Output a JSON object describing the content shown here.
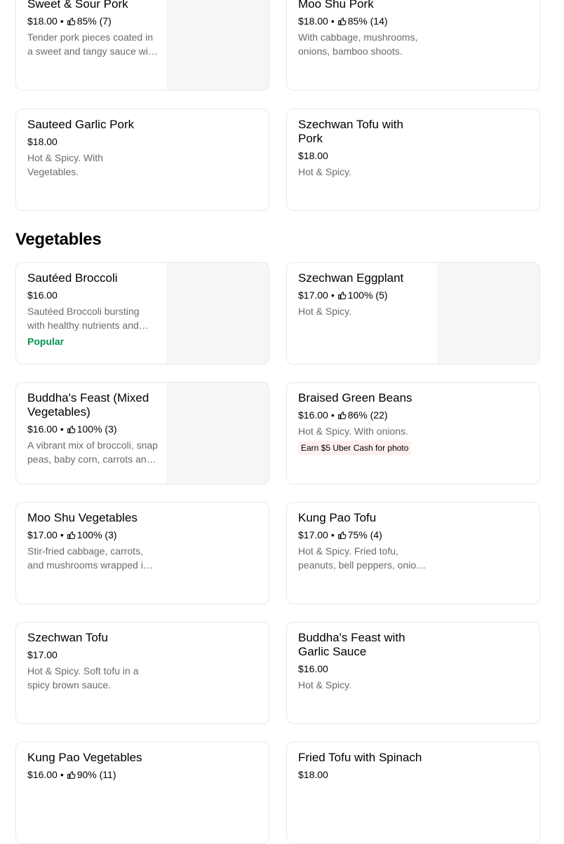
{
  "section": {
    "title": "Vegetables"
  },
  "items": [
    {
      "name": "Sweet & Sour Pork",
      "price": "$18.00",
      "rating": "85% (7)",
      "desc": "Tender pork pieces coated in a sweet and tangy sauce with pineapple and peppers."
    },
    {
      "name": "Moo Shu Pork",
      "price": "$18.00",
      "rating": "85% (14)",
      "desc": "With cabbage, mushrooms, onions, bamboo shoots."
    },
    {
      "name": "Sauteed Garlic Pork",
      "price": "$18.00",
      "desc": "Hot & Spicy. With Vegetables."
    },
    {
      "name": "Szechwan Tofu with Pork",
      "price": "$18.00",
      "desc": "Hot & Spicy."
    },
    {
      "name": "Sautéed Broccoli",
      "price": "$16.00",
      "desc": "Sautéed Broccoli bursting with healthy nutrients and flavor.",
      "badge": "Popular"
    },
    {
      "name": "Szechwan Eggplant",
      "price": "$17.00",
      "rating": "100% (5)",
      "desc": "Hot & Spicy."
    },
    {
      "name": "Buddha's Feast (Mixed Vegetables)",
      "price": "$16.00",
      "rating": "100% (3)",
      "desc": "A vibrant mix of broccoli, snap peas, baby corn, carrots and mushrooms."
    },
    {
      "name": "Braised Green Beans",
      "price": "$16.00",
      "rating": "86% (22)",
      "desc": "Hot & Spicy. With onions.",
      "promo": "Earn $5 Uber Cash for photo"
    },
    {
      "name": "Moo Shu Vegetables",
      "price": "$17.00",
      "rating": "100% (3)",
      "desc": "Stir-fried cabbage, carrots, and mushrooms wrapped in thin pancakes."
    },
    {
      "name": "Kung Pao Tofu",
      "price": "$17.00",
      "rating": "75% (4)",
      "desc": "Hot & Spicy. Fried tofu, peanuts, bell peppers, onions and celery."
    },
    {
      "name": "Szechwan Tofu",
      "price": "$17.00",
      "desc": "Hot & Spicy. Soft tofu in a spicy brown sauce."
    },
    {
      "name": "Buddha's Feast with Garlic Sauce",
      "price": "$16.00",
      "desc": "Hot & Spicy."
    },
    {
      "name": "Kung Pao Vegetables",
      "price": "$16.00",
      "rating": "90% (11)",
      "desc": ""
    },
    {
      "name": "Fried Tofu with Spinach",
      "price": "$18.00",
      "desc": ""
    }
  ],
  "icons": {
    "rating": "thumbs-up-icon"
  },
  "colors": {
    "popular": "#05944f",
    "promo_bg": "#fff0ee",
    "muted": "#6b6b6b",
    "image_placeholder": "#f6f6f6"
  }
}
